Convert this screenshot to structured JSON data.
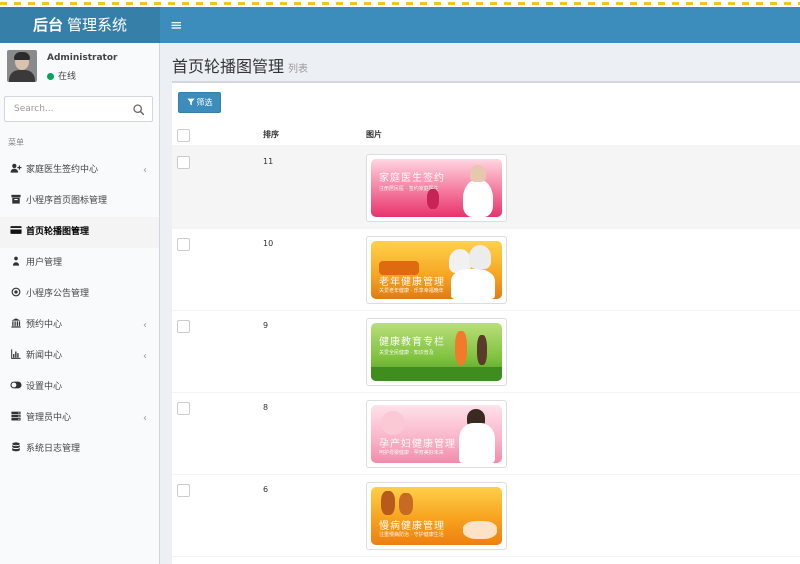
{
  "header": {
    "logo_bold": "后台",
    "logo_text": "管理系统",
    "toggle_icon": "≡"
  },
  "user": {
    "name": "Administrator",
    "status": "在线",
    "status_color": "#00a65a"
  },
  "search": {
    "placeholder": "Search..."
  },
  "sidebar": {
    "header": "菜单",
    "items": [
      {
        "label": "家庭医生签约中心",
        "icon": "user-plus-icon",
        "has_children": true,
        "active": false
      },
      {
        "label": "小程序首页图标管理",
        "icon": "archive-icon",
        "has_children": false,
        "active": false
      },
      {
        "label": "首页轮播图管理",
        "icon": "credit-card-icon",
        "has_children": false,
        "active": true
      },
      {
        "label": "用户管理",
        "icon": "user-group-icon",
        "has_children": false,
        "active": false
      },
      {
        "label": "小程序公告管理",
        "icon": "dot-circle-icon",
        "has_children": false,
        "active": false
      },
      {
        "label": "预约中心",
        "icon": "bank-icon",
        "has_children": true,
        "active": false
      },
      {
        "label": "新闻中心",
        "icon": "bar-chart-icon",
        "has_children": true,
        "active": false
      },
      {
        "label": "设置中心",
        "icon": "toggle-icon",
        "has_children": false,
        "active": false
      },
      {
        "label": "管理员中心",
        "icon": "server-icon",
        "has_children": true,
        "active": false
      },
      {
        "label": "系统日志管理",
        "icon": "database-icon",
        "has_children": false,
        "active": false
      }
    ],
    "chevron": "‹"
  },
  "page": {
    "title": "首页轮播图管理",
    "subtitle": "列表",
    "filter_label": "筛选"
  },
  "table": {
    "columns": [
      "排序",
      "图片"
    ],
    "rows": [
      {
        "sort": "11",
        "banner_title": "家庭医生签约",
        "banner_sub": "注册居民医 · 签约家庭医生",
        "theme": "pink-red",
        "highlighted": true
      },
      {
        "sort": "10",
        "banner_title": "老年健康管理",
        "banner_sub": "关爱老年健康 · 乐享幸福晚年",
        "theme": "orange",
        "highlighted": false
      },
      {
        "sort": "9",
        "banner_title": "健康教育专栏",
        "banner_sub": "关爱全民健康 · 知识普及",
        "theme": "green",
        "highlighted": false
      },
      {
        "sort": "8",
        "banner_title": "孕产妇健康管理",
        "banner_sub": "呵护母婴健康 · 孕育美好未来",
        "theme": "light-pink",
        "highlighted": false
      },
      {
        "sort": "6",
        "banner_title": "慢病健康管理",
        "banner_sub": "注重慢病防治 · 守护健康生活",
        "theme": "orange-red",
        "highlighted": false
      }
    ]
  },
  "colors": {
    "header": "#3c8dbc",
    "logo_bg": "#367fa9",
    "accent": "#3c8dbc"
  }
}
